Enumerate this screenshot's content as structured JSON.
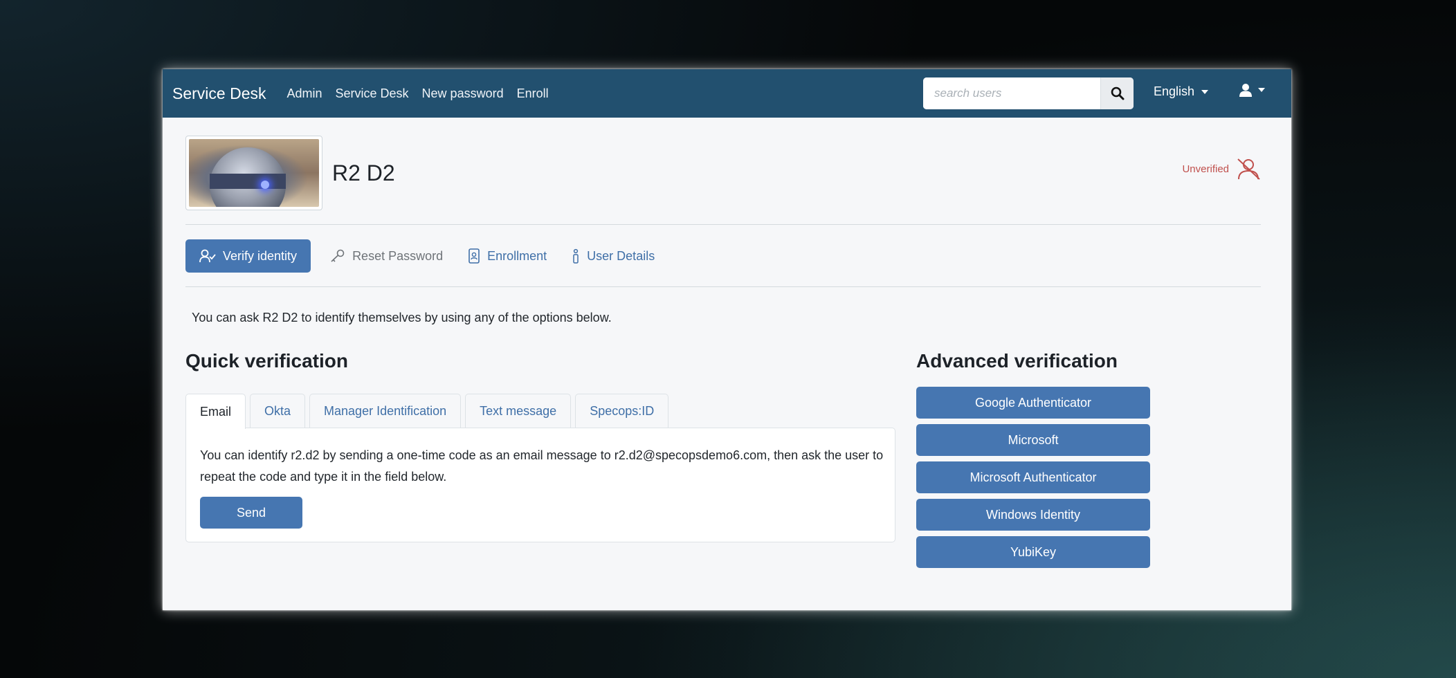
{
  "navbar": {
    "brand": "Service Desk",
    "links": [
      "Admin",
      "Service Desk",
      "New password",
      "Enroll"
    ],
    "search_placeholder": "search users",
    "language": "English"
  },
  "profile": {
    "name": "R2 D2",
    "status": "Unverified"
  },
  "tabs": {
    "verify": "Verify identity",
    "reset": "Reset Password",
    "enrollment": "Enrollment",
    "details": "User Details"
  },
  "intro": "You can ask R2 D2 to identify themselves by using any of the options below.",
  "quick": {
    "heading": "Quick verification",
    "tabs": [
      "Email",
      "Okta",
      "Manager Identification",
      "Text message",
      "Specops:ID"
    ],
    "panel_text": "You can identify r2.d2 by sending a one-time code as an email message to r2.d2@specopsdemo6.com, then ask the user to repeat the code and type it in the field below.",
    "send_label": "Send"
  },
  "advanced": {
    "heading": "Advanced verification",
    "buttons": [
      "Google Authenticator",
      "Microsoft",
      "Microsoft Authenticator",
      "Windows Identity",
      "YubiKey"
    ]
  },
  "colors": {
    "navbar": "#22506f",
    "primary": "#4676b1",
    "link": "#3f6fa7",
    "unverified": "#c0504d"
  }
}
